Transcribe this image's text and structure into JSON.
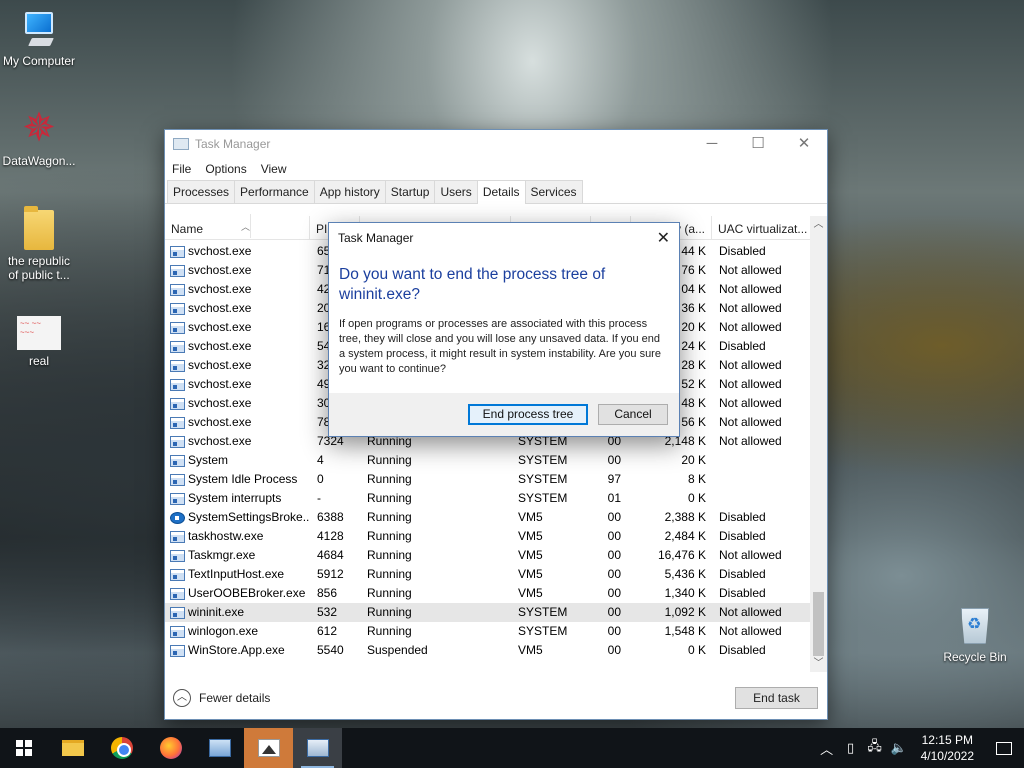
{
  "desktop": {
    "icons": [
      {
        "label": "My Computer"
      },
      {
        "label": "DataWagon..."
      },
      {
        "label": "the republic of public t..."
      },
      {
        "label": "real"
      },
      {
        "label": "Recycle Bin"
      }
    ]
  },
  "task_manager": {
    "title": "Task Manager",
    "menu": [
      "File",
      "Options",
      "View"
    ],
    "tabs": [
      "Processes",
      "Performance",
      "App history",
      "Startup",
      "Users",
      "Details",
      "Services"
    ],
    "active_tab": "Details",
    "columns": {
      "name": "Name",
      "pid": "PID",
      "status": "",
      "user": "",
      "cpu": "",
      "memory": "y (a...",
      "uac": "UAC virtualizat..."
    },
    "rows": [
      {
        "name": "svchost.exe",
        "pid": "65",
        "status": "",
        "user": "",
        "cpu": "",
        "mem": "44 K",
        "uac": "Disabled"
      },
      {
        "name": "svchost.exe",
        "pid": "71",
        "status": "",
        "user": "",
        "cpu": "",
        "mem": "76 K",
        "uac": "Not allowed"
      },
      {
        "name": "svchost.exe",
        "pid": "42",
        "status": "",
        "user": "",
        "cpu": "",
        "mem": "04 K",
        "uac": "Not allowed"
      },
      {
        "name": "svchost.exe",
        "pid": "20",
        "status": "",
        "user": "",
        "cpu": "",
        "mem": "36 K",
        "uac": "Not allowed"
      },
      {
        "name": "svchost.exe",
        "pid": "16",
        "status": "",
        "user": "",
        "cpu": "",
        "mem": "20 K",
        "uac": "Not allowed"
      },
      {
        "name": "svchost.exe",
        "pid": "54",
        "status": "",
        "user": "",
        "cpu": "",
        "mem": "24 K",
        "uac": "Disabled"
      },
      {
        "name": "svchost.exe",
        "pid": "32",
        "status": "",
        "user": "",
        "cpu": "",
        "mem": "28 K",
        "uac": "Not allowed"
      },
      {
        "name": "svchost.exe",
        "pid": "49",
        "status": "",
        "user": "",
        "cpu": "",
        "mem": "52 K",
        "uac": "Not allowed"
      },
      {
        "name": "svchost.exe",
        "pid": "30",
        "status": "",
        "user": "",
        "cpu": "",
        "mem": "48 K",
        "uac": "Not allowed"
      },
      {
        "name": "svchost.exe",
        "pid": "78",
        "status": "",
        "user": "",
        "cpu": "",
        "mem": "56 K",
        "uac": "Not allowed"
      },
      {
        "name": "svchost.exe",
        "pid": "7324",
        "status": "Running",
        "user": "SYSTEM",
        "cpu": "00",
        "mem": "2,148 K",
        "uac": "Not allowed"
      },
      {
        "name": "System",
        "pid": "4",
        "status": "Running",
        "user": "SYSTEM",
        "cpu": "00",
        "mem": "20 K",
        "uac": ""
      },
      {
        "name": "System Idle Process",
        "pid": "0",
        "status": "Running",
        "user": "SYSTEM",
        "cpu": "97",
        "mem": "8 K",
        "uac": ""
      },
      {
        "name": "System interrupts",
        "pid": "-",
        "status": "Running",
        "user": "SYSTEM",
        "cpu": "01",
        "mem": "0 K",
        "uac": ""
      },
      {
        "name": "SystemSettingsBroke...",
        "pid": "6388",
        "status": "Running",
        "user": "VM5",
        "cpu": "00",
        "mem": "2,388 K",
        "uac": "Disabled",
        "icon": "gear"
      },
      {
        "name": "taskhostw.exe",
        "pid": "4128",
        "status": "Running",
        "user": "VM5",
        "cpu": "00",
        "mem": "2,484 K",
        "uac": "Disabled"
      },
      {
        "name": "Taskmgr.exe",
        "pid": "4684",
        "status": "Running",
        "user": "VM5",
        "cpu": "00",
        "mem": "16,476 K",
        "uac": "Not allowed"
      },
      {
        "name": "TextInputHost.exe",
        "pid": "5912",
        "status": "Running",
        "user": "VM5",
        "cpu": "00",
        "mem": "5,436 K",
        "uac": "Disabled"
      },
      {
        "name": "UserOOBEBroker.exe",
        "pid": "856",
        "status": "Running",
        "user": "VM5",
        "cpu": "00",
        "mem": "1,340 K",
        "uac": "Disabled"
      },
      {
        "name": "wininit.exe",
        "pid": "532",
        "status": "Running",
        "user": "SYSTEM",
        "cpu": "00",
        "mem": "1,092 K",
        "uac": "Not allowed",
        "selected": true
      },
      {
        "name": "winlogon.exe",
        "pid": "612",
        "status": "Running",
        "user": "SYSTEM",
        "cpu": "00",
        "mem": "1,548 K",
        "uac": "Not allowed"
      },
      {
        "name": "WinStore.App.exe",
        "pid": "5540",
        "status": "Suspended",
        "user": "VM5",
        "cpu": "00",
        "mem": "0 K",
        "uac": "Disabled"
      }
    ],
    "footer": {
      "fewer_details": "Fewer details",
      "end_task": "End task"
    }
  },
  "dialog": {
    "title": "Task Manager",
    "heading": "Do you want to end the process tree of wininit.exe?",
    "body": "If open programs or processes are associated with this process tree, they will close and you will lose any unsaved data. If you end a system process, it might result in system instability. Are you sure you want to continue?",
    "primary_button": "End process tree",
    "cancel_button": "Cancel"
  },
  "taskbar": {
    "apps": [
      "file-explorer-icon",
      "chrome-icon",
      "firefox-icon",
      "network-computer-icon",
      "photos-icon",
      "task-manager-icon"
    ],
    "time": "12:15 PM",
    "date": "4/10/2022"
  }
}
